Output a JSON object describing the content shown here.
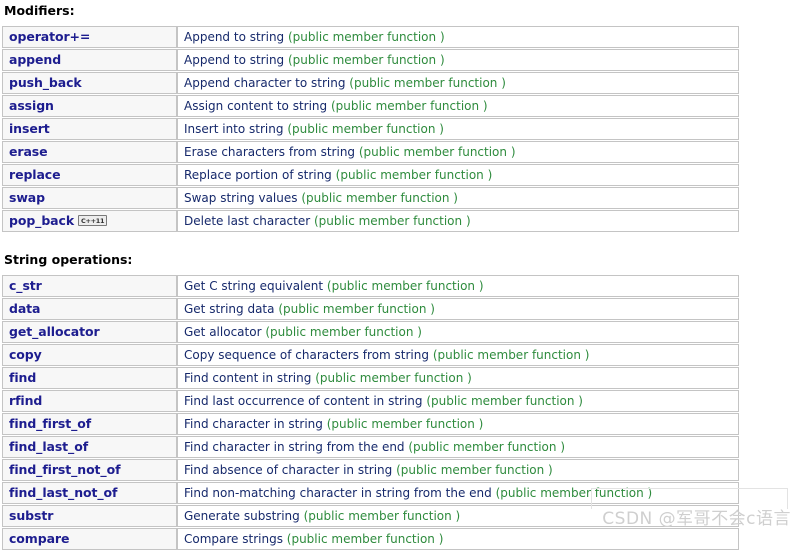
{
  "sections": [
    {
      "heading": "Modifiers:",
      "rows": [
        {
          "name": "operator+=",
          "badge": null,
          "desc": "Append to string",
          "kind": "(public member function )"
        },
        {
          "name": "append",
          "badge": null,
          "desc": "Append to string",
          "kind": "(public member function )"
        },
        {
          "name": "push_back",
          "badge": null,
          "desc": "Append character to string",
          "kind": "(public member function )"
        },
        {
          "name": "assign",
          "badge": null,
          "desc": "Assign content to string",
          "kind": "(public member function )"
        },
        {
          "name": "insert",
          "badge": null,
          "desc": "Insert into string",
          "kind": "(public member function )"
        },
        {
          "name": "erase",
          "badge": null,
          "desc": "Erase characters from string",
          "kind": "(public member function )"
        },
        {
          "name": "replace",
          "badge": null,
          "desc": "Replace portion of string",
          "kind": "(public member function )"
        },
        {
          "name": "swap",
          "badge": null,
          "desc": "Swap string values",
          "kind": "(public member function )"
        },
        {
          "name": "pop_back",
          "badge": "C++11",
          "desc": "Delete last character",
          "kind": "(public member function )"
        }
      ]
    },
    {
      "heading": "String operations:",
      "rows": [
        {
          "name": "c_str",
          "badge": null,
          "desc": "Get C string equivalent",
          "kind": "(public member function )"
        },
        {
          "name": "data",
          "badge": null,
          "desc": "Get string data",
          "kind": "(public member function )"
        },
        {
          "name": "get_allocator",
          "badge": null,
          "desc": "Get allocator",
          "kind": "(public member function )"
        },
        {
          "name": "copy",
          "badge": null,
          "desc": "Copy sequence of characters from string",
          "kind": "(public member function )"
        },
        {
          "name": "find",
          "badge": null,
          "desc": "Find content in string",
          "kind": "(public member function )"
        },
        {
          "name": "rfind",
          "badge": null,
          "desc": "Find last occurrence of content in string",
          "kind": "(public member function )"
        },
        {
          "name": "find_first_of",
          "badge": null,
          "desc": "Find character in string",
          "kind": "(public member function )"
        },
        {
          "name": "find_last_of",
          "badge": null,
          "desc": "Find character in string from the end",
          "kind": "(public member function )"
        },
        {
          "name": "find_first_not_of",
          "badge": null,
          "desc": "Find absence of character in string",
          "kind": "(public member function )"
        },
        {
          "name": "find_last_not_of",
          "badge": null,
          "desc": "Find non-matching character in string from the end",
          "kind": "(public member function )"
        },
        {
          "name": "substr",
          "badge": null,
          "desc": "Generate substring",
          "kind": "(public member function )"
        },
        {
          "name": "compare",
          "badge": null,
          "desc": "Compare strings",
          "kind": "(public member function )"
        }
      ]
    }
  ],
  "watermark": {
    "text": "CSDN @军哥不会c语言"
  },
  "colors": {
    "link": "#1d1d8f",
    "description": "#16296b",
    "member_kind": "#2e8b3d",
    "cell_border": "#c4c4c4",
    "name_cell_bg": "#f7f7f7",
    "watermark": "#cfcfcf"
  }
}
